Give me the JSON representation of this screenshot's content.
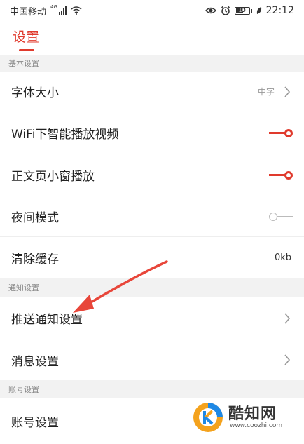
{
  "status": {
    "carrier": "中国移动",
    "signal_label": "4G",
    "time": "22:12",
    "battery_level": "10"
  },
  "header": {
    "title": "设置"
  },
  "sections": {
    "basic": "基本设置",
    "notify": "通知设置",
    "account": "账号设置"
  },
  "rows": {
    "font_size": {
      "label": "字体大小",
      "value": "中字"
    },
    "wifi_autoplay": {
      "label": "WiFi下智能播放视频",
      "on": true
    },
    "pip": {
      "label": "正文页小窗播放",
      "on": true
    },
    "night_mode": {
      "label": "夜间模式",
      "on": false
    },
    "clear_cache": {
      "label": "清除缓存",
      "value": "0kb"
    },
    "push_settings": {
      "label": "推送通知设置"
    },
    "message_settings": {
      "label": "消息设置"
    },
    "account_settings": {
      "label": "账号设置"
    }
  },
  "watermark": {
    "name": "酷知网",
    "url": "www.coozhi.com"
  },
  "colors": {
    "accent": "#e03a2d",
    "section_bg": "#f2f2f2"
  }
}
